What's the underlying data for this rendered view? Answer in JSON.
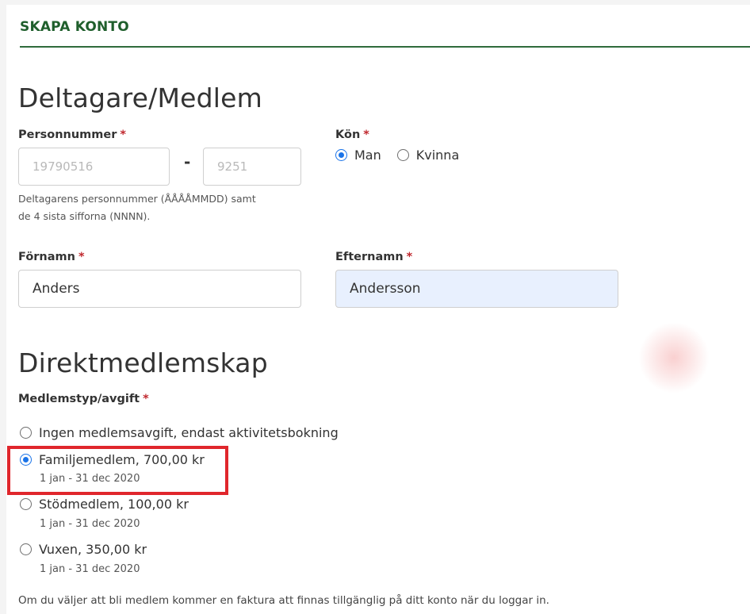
{
  "header": {
    "title": "SKAPA KONTO"
  },
  "participant": {
    "title": "Deltagare/Medlem",
    "personnummer": {
      "label": "Personnummer",
      "required": "*",
      "date_placeholder": "19790516",
      "separator": "-",
      "last4_placeholder": "9251",
      "hint_line1": "Deltagarens personnummer (ÅÅÅÅMMDD) samt",
      "hint_line2": "de 4 sista sifforna (NNNN)."
    },
    "gender": {
      "label": "Kön",
      "required": "*",
      "options": [
        {
          "label": "Man",
          "selected": true
        },
        {
          "label": "Kvinna",
          "selected": false
        }
      ]
    },
    "first_name": {
      "label": "Förnamn",
      "required": "*",
      "value": "Anders"
    },
    "last_name": {
      "label": "Efternamn",
      "required": "*",
      "value": "Andersson"
    }
  },
  "membership": {
    "title": "Direktmedlemskap",
    "type_label": "Medlemstyp/avgift",
    "required": "*",
    "options": [
      {
        "label": "Ingen medlemsavgift, endast aktivitetsbokning",
        "period": "",
        "selected": false
      },
      {
        "label": "Familjemedlem, 700,00 kr",
        "period": "1 jan - 31 dec 2020",
        "selected": true
      },
      {
        "label": "Stödmedlem, 100,00 kr",
        "period": "1 jan - 31 dec 2020",
        "selected": false
      },
      {
        "label": "Vuxen, 350,00 kr",
        "period": "1 jan - 31 dec 2020",
        "selected": false
      }
    ],
    "note": "Om du väljer att bli medlem kommer en faktura att finnas tillgänglig på ditt konto när du loggar in."
  },
  "colors": {
    "header_green": "#1f5f2c",
    "required_red": "#c0282e",
    "radio_blue": "#1a73e8",
    "highlight_red": "#e0262c",
    "autofill_bg": "#e8f0fe"
  }
}
